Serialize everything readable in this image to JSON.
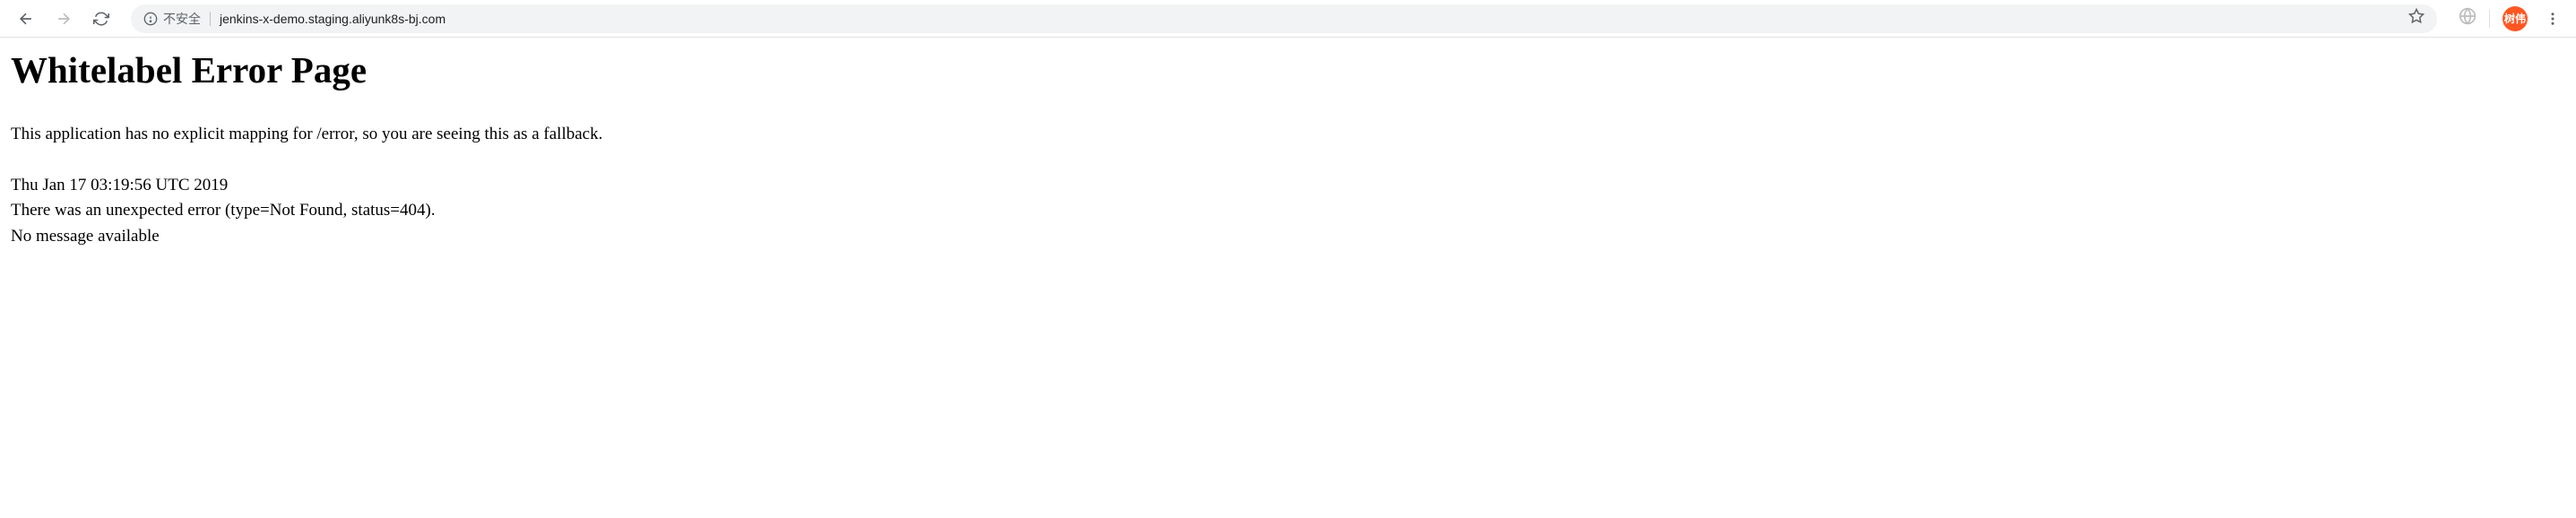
{
  "toolbar": {
    "security_label": "不安全",
    "url": "jenkins-x-demo.staging.aliyunk8s-bj.com",
    "avatar_text": "树伟"
  },
  "page": {
    "title": "Whitelabel Error Page",
    "fallback_message": "This application has no explicit mapping for /error, so you are seeing this as a fallback.",
    "timestamp": "Thu Jan 17 03:19:56 UTC 2019",
    "error_details": "There was an unexpected error (type=Not Found, status=404).",
    "message": "No message available"
  }
}
